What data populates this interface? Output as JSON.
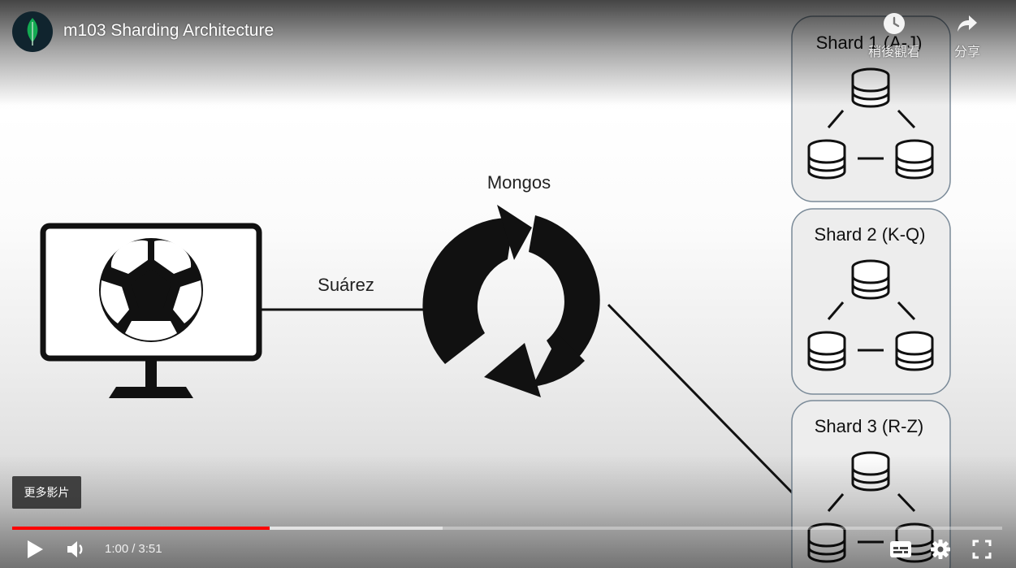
{
  "player": {
    "title": "m103 Sharding Architecture",
    "watch_later_label": "稍後觀看",
    "share_label": "分享",
    "more_videos_label": "更多影片",
    "current_time": "1:00",
    "duration": "3:51",
    "time_separator": "/",
    "progress": {
      "played_fraction": 0.26,
      "buffered_fraction": 0.435
    },
    "icons": {
      "channel_logo": "mongodb-leaf-icon",
      "watch_later": "clock-icon",
      "share": "share-arrow-icon",
      "play": "play-icon",
      "volume": "volume-icon",
      "subtitles": "subtitles-icon",
      "settings": "gear-icon",
      "fullscreen": "fullscreen-icon"
    },
    "colors": {
      "progress_played": "#ff0000",
      "logo_leaf": "#13aa52",
      "logo_background": "#10242e"
    }
  },
  "diagram": {
    "router_label": "Mongos",
    "query_label": "Suárez",
    "shards": [
      {
        "label": "Shard 1 (A-J)"
      },
      {
        "label": "Shard 2 (K-Q)"
      },
      {
        "label": "Shard 3 (R-Z)"
      }
    ]
  }
}
